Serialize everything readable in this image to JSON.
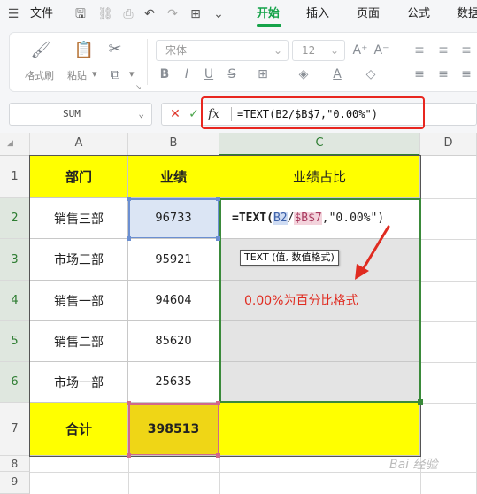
{
  "menu": {
    "file_label": "文件",
    "tabs": [
      "开始",
      "插入",
      "页面",
      "公式",
      "数据"
    ]
  },
  "ribbon": {
    "format_painter": "格式刷",
    "paste": "粘贴",
    "font_name": "宋体",
    "font_size": "12"
  },
  "formula_bar": {
    "name_box": "SUM",
    "fx_label": "fx",
    "formula": "=TEXT(B2/$B$7,\"0.00%\")"
  },
  "grid": {
    "columns": [
      "A",
      "B",
      "C",
      "D"
    ],
    "rows": [
      "1",
      "2",
      "3",
      "4",
      "5",
      "6",
      "7",
      "8",
      "9"
    ],
    "headers": {
      "dept": "部门",
      "perf": "业绩",
      "ratio": "业绩占比"
    },
    "data": [
      {
        "dept": "销售三部",
        "value": "96733"
      },
      {
        "dept": "市场三部",
        "value": "95921"
      },
      {
        "dept": "销售一部",
        "value": "94604"
      },
      {
        "dept": "销售二部",
        "value": "85620"
      },
      {
        "dept": "市场一部",
        "value": "25635"
      }
    ],
    "total_label": "合计",
    "total_value": "398513",
    "edit_formula": {
      "prefix": "=TEXT(",
      "ref1": "B2",
      "slash": "/",
      "ref2": "$B$7",
      "suffix": ",\"0.00%\")"
    },
    "tooltip": "TEXT (值, 数值格式)",
    "annotation": "0.00%为百分比格式"
  },
  "watermark": "Bai 经验",
  "colors": {
    "accent": "#16a34a",
    "highlight": "#ffff00",
    "annotation": "#e02b20"
  }
}
